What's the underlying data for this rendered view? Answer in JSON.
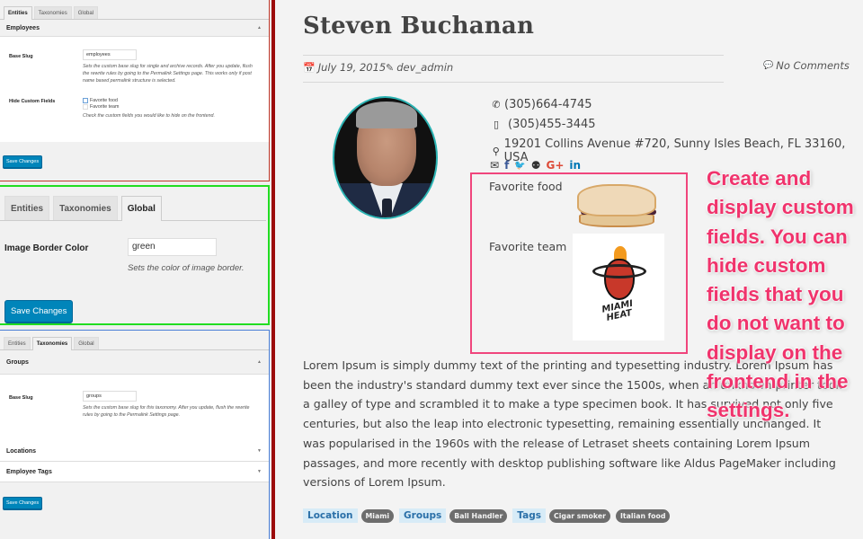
{
  "admin": {
    "panel_entities": {
      "tabs": [
        {
          "label": "Entities",
          "active": true
        },
        {
          "label": "Taxonomies",
          "active": false
        },
        {
          "label": "Global",
          "active": false
        }
      ],
      "section_title": "Employees",
      "section_toggle": "▲",
      "base_slug_label": "Base Slug",
      "base_slug_value": "employees",
      "base_slug_desc": "Sets the custom base slug for single and archive records. After you update, flush the rewrite rules by going to the Permalink Settings page. This works only if post name based permalink structure is selected.",
      "hide_fields_label": "Hide Custom Fields",
      "hide_fields_options": [
        {
          "label": "Favorite food",
          "checked": false
        },
        {
          "label": "Favorite team",
          "checked": false
        }
      ],
      "hide_fields_desc": "Check the custom fields you would like to hide on the frontend.",
      "save_label": "Save Changes"
    },
    "panel_global": {
      "tabs": [
        {
          "label": "Entities",
          "active": false
        },
        {
          "label": "Taxonomies",
          "active": false
        },
        {
          "label": "Global",
          "active": true
        }
      ],
      "border_color_label": "Image Border Color",
      "border_color_value": "green",
      "border_color_desc": "Sets the color of image border.",
      "save_label": "Save Changes"
    },
    "panel_taxonomies": {
      "tabs": [
        {
          "label": "Entities",
          "active": false
        },
        {
          "label": "Taxonomies",
          "active": true
        },
        {
          "label": "Global",
          "active": false
        }
      ],
      "sections": [
        {
          "title": "Groups",
          "toggle": "▲"
        },
        {
          "title": "Locations",
          "toggle": "▼"
        },
        {
          "title": "Employee Tags",
          "toggle": "▼"
        }
      ],
      "base_slug_label": "Base Slug",
      "base_slug_value": "groups",
      "base_slug_desc": "Sets the custom base slug for this taxonomy. After you update, flush the rewrite rules by going to the Permalink Settings page.",
      "save_label": "Save Changes"
    }
  },
  "front": {
    "title": "Steven Buchanan",
    "date": "July 19, 2015",
    "author": "dev_admin",
    "comments": "No Comments",
    "icons": {
      "calendar": "📅",
      "pencil": "✎",
      "comment": "💬",
      "phone": "✆",
      "mobile": "▯",
      "pin": "⚲"
    },
    "phone": "(305)664-4745",
    "mobile": "(305)455-3445",
    "address": "19201 Collins Avenue #720, Sunny Isles Beach, FL 33160, USA",
    "social": [
      {
        "name": "email",
        "glyph": "✉",
        "color": "#333333"
      },
      {
        "name": "facebook",
        "glyph": "f",
        "color": "#3b5998"
      },
      {
        "name": "twitter",
        "glyph": "🐦",
        "color": "#1da1f2"
      },
      {
        "name": "github",
        "glyph": "⚉",
        "color": "#333333"
      },
      {
        "name": "google-plus",
        "glyph": "G+",
        "color": "#dd4b39"
      },
      {
        "name": "linkedin",
        "glyph": "in",
        "color": "#0077b5"
      }
    ],
    "custom_fields": [
      {
        "label": "Favorite food",
        "image": "peanut butter and jelly sandwich"
      },
      {
        "label": "Favorite team",
        "image": "Miami Heat logo",
        "logo_text": "MIAMI HEAT"
      }
    ],
    "body": "Lorem Ipsum is simply dummy text of the printing and typesetting industry. Lorem Ipsum has been the industry's standard dummy text ever since the 1500s, when an unknown printer took a galley of type and scrambled it to make a type specimen book. It has survived not only five centuries, but also the leap into electronic typesetting, remaining essentially unchanged. It was popularised in the 1960s with the release of Letraset sheets containing Lorem Ipsum passages, and more recently with desktop publishing software like Aldus PageMaker including versions of Lorem Ipsum.",
    "annotation": "Create and display custom fields. You can hide custom fields that you do not want to display on the frontend in the settings.",
    "taxonomies": [
      {
        "label": "Location",
        "terms": [
          "Miami"
        ]
      },
      {
        "label": "Groups",
        "terms": [
          "Ball Handler"
        ]
      },
      {
        "label": "Tags",
        "terms": [
          "Cigar smoker",
          "Italian food"
        ]
      }
    ]
  },
  "colors": {
    "wp_button": "#0085ba",
    "annotation": "#f0336c",
    "highlight_box": "#f0457c",
    "avatar_border": "#2bb3b3",
    "divider": "#9c0b0b"
  }
}
